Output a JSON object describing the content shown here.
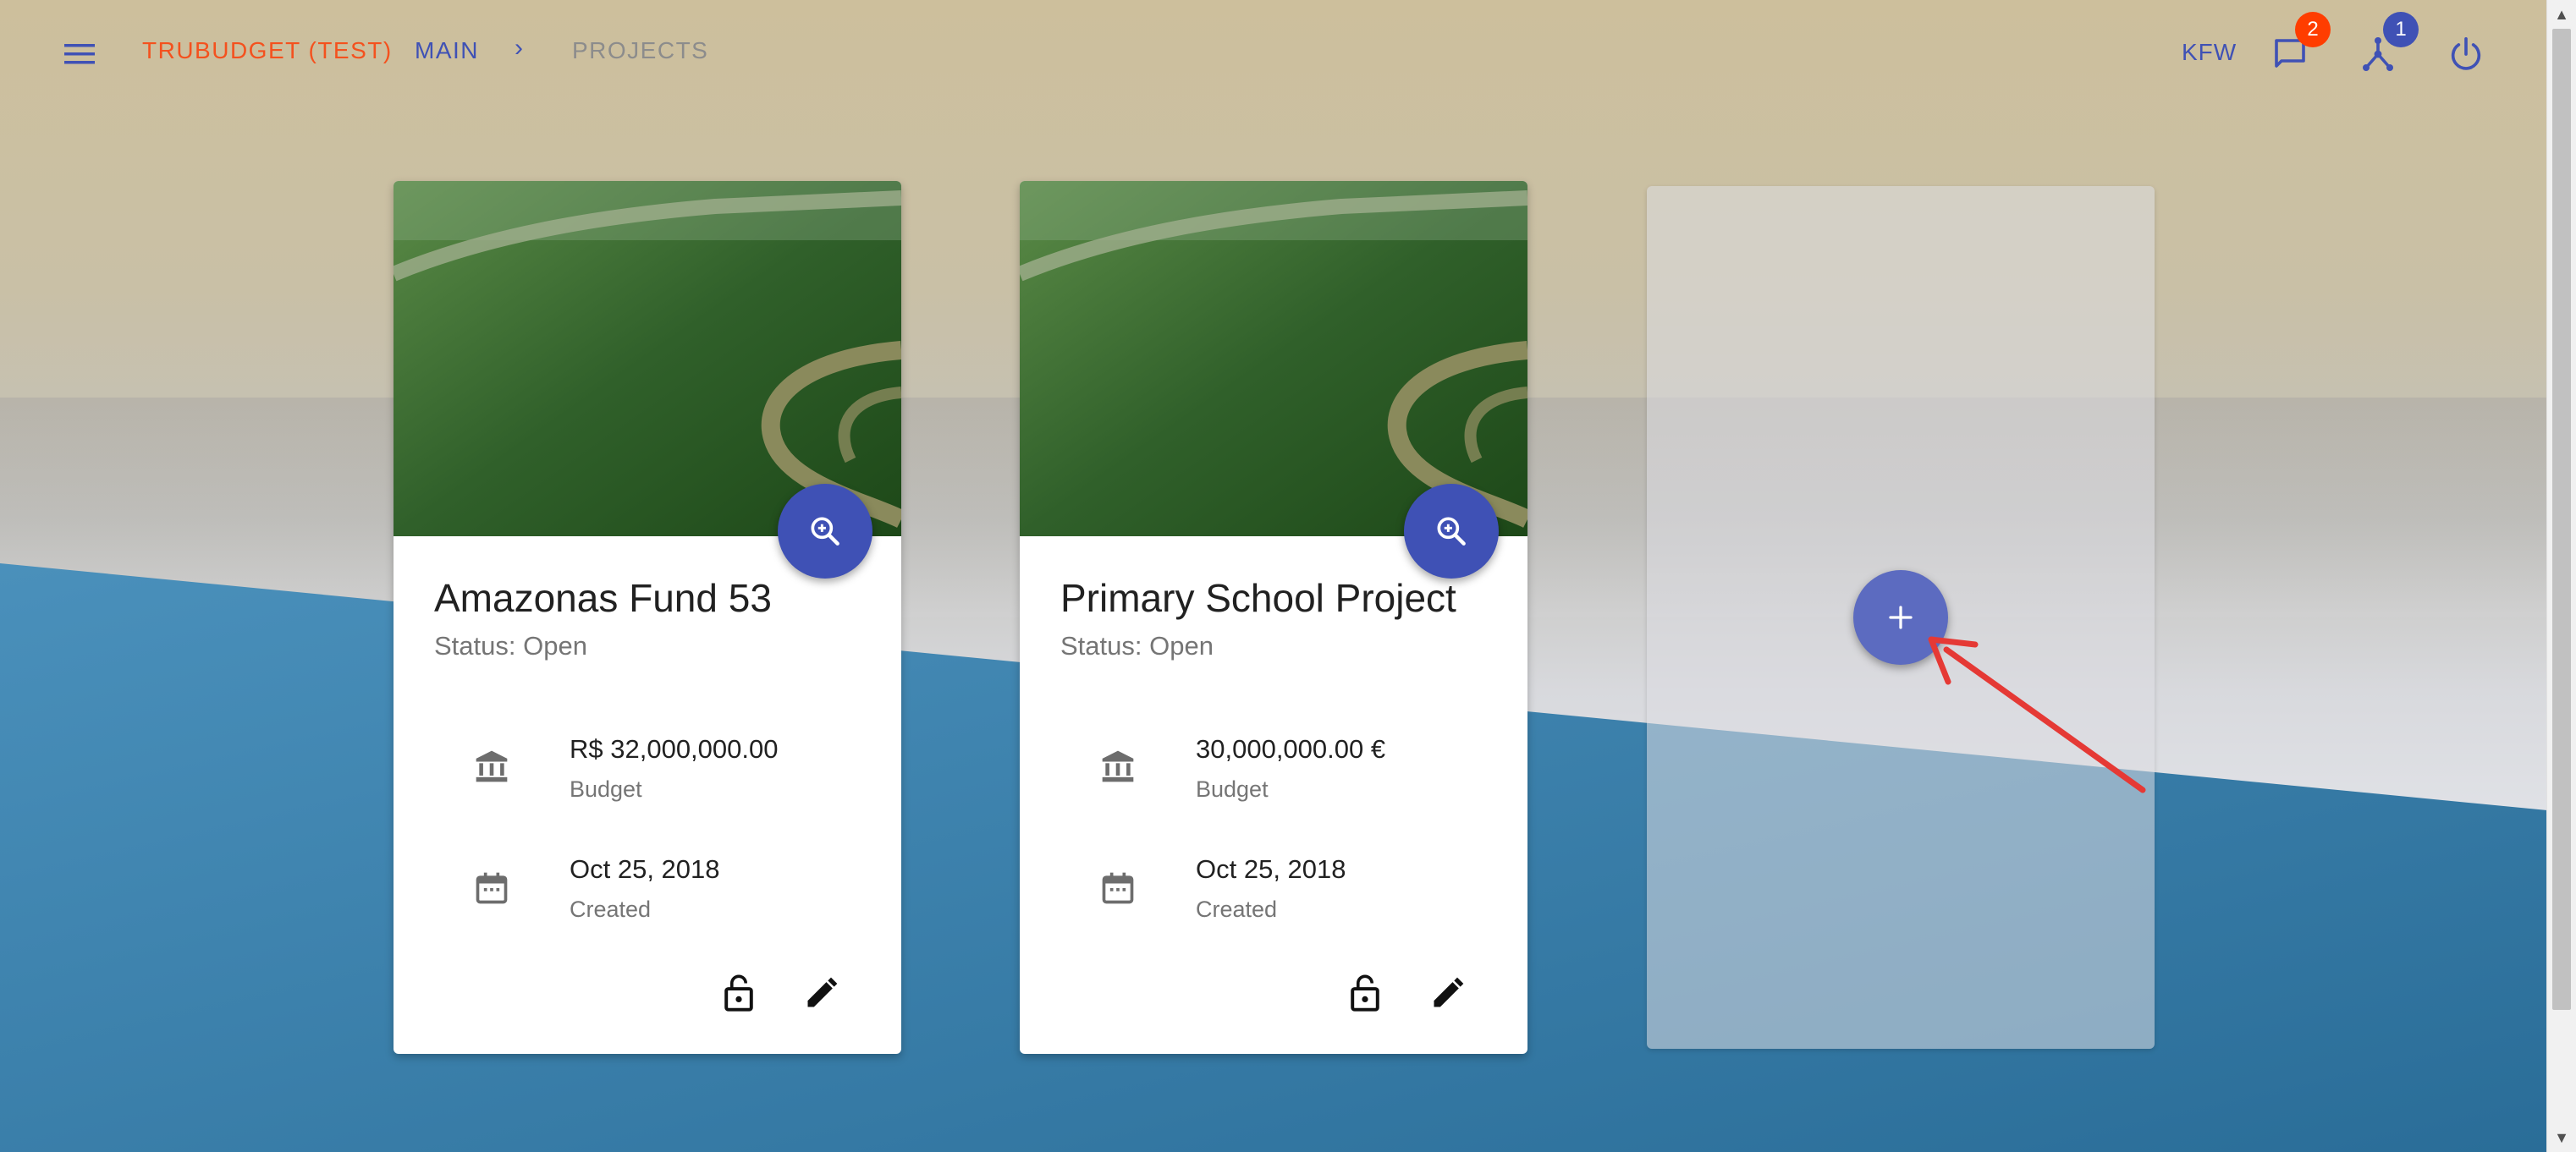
{
  "header": {
    "brand": "TRUBUDGET (TEST)",
    "breadcrumb_main": "MAIN",
    "breadcrumb_separator": "›",
    "breadcrumb_current": "PROJECTS",
    "organization": "KFW",
    "notifications_count": "2",
    "network_count": "1"
  },
  "projects": [
    {
      "title": "Amazonas Fund 53",
      "status": "Status: Open",
      "budget": "R$ 32,000,000.00",
      "budget_label": "Budget",
      "created": "Oct 25, 2018",
      "created_label": "Created"
    },
    {
      "title": "Primary School Project",
      "status": "Status: Open",
      "budget": "30,000,000.00 €",
      "budget_label": "Budget",
      "created": "Oct 25, 2018",
      "created_label": "Created"
    }
  ],
  "icons": {
    "menu": "menu-icon",
    "chat": "chat-icon",
    "network": "network-icon",
    "power": "power-icon",
    "zoom": "zoom-in-icon",
    "bank": "bank-icon",
    "calendar": "calendar-icon",
    "lock": "lock-open-icon",
    "edit": "pencil-icon",
    "add": "plus-icon"
  },
  "colors": {
    "primary": "#3f51b5",
    "brand": "#f4511e",
    "badge_red": "#ff3d00",
    "add_fab": "#5c6bc0",
    "annotation_arrow": "#e53935",
    "blue_bg": "#3a7fae"
  }
}
